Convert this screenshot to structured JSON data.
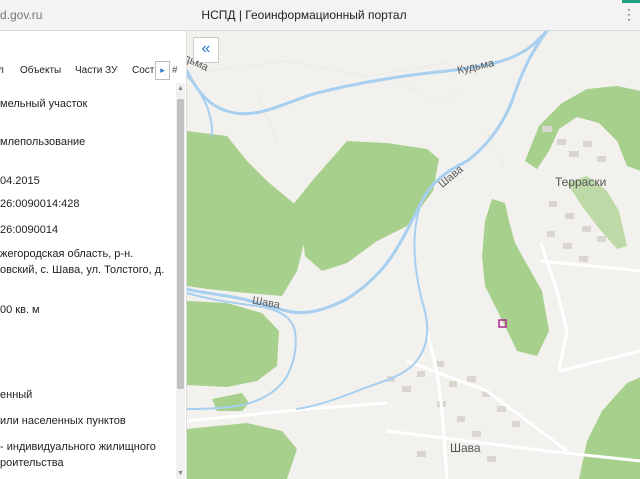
{
  "browser": {
    "url": "d.gov.ru",
    "title": "НСПД | Геоинформационный портал"
  },
  "panel": {
    "tabs": [
      "л",
      "Объекты",
      "Части ЗУ",
      "Соста"
    ],
    "fields": [
      "мельный участок",
      "млепользование",
      "04.2015",
      "26:0090014:428",
      "26:0090014",
      "жегородская область, р-н.\nовский, с. Шава, ул. Толстого, д.",
      "00 кв. м",
      "енный",
      "или населенных пунктов",
      "- индивидуального жилищного\nроительства"
    ]
  },
  "map": {
    "labels": {
      "river_kudma": "Кудьма",
      "river_kudma_top": "дьма",
      "river_shava_1": "Шава",
      "river_shava_2": "Шава",
      "village_terraski": "Терраски",
      "village_shava": "Шава"
    },
    "colors": {
      "forest": "#a8d08d",
      "water": "#a6cff0",
      "background": "#f2f1ee",
      "parcel": "#b0278a"
    }
  }
}
